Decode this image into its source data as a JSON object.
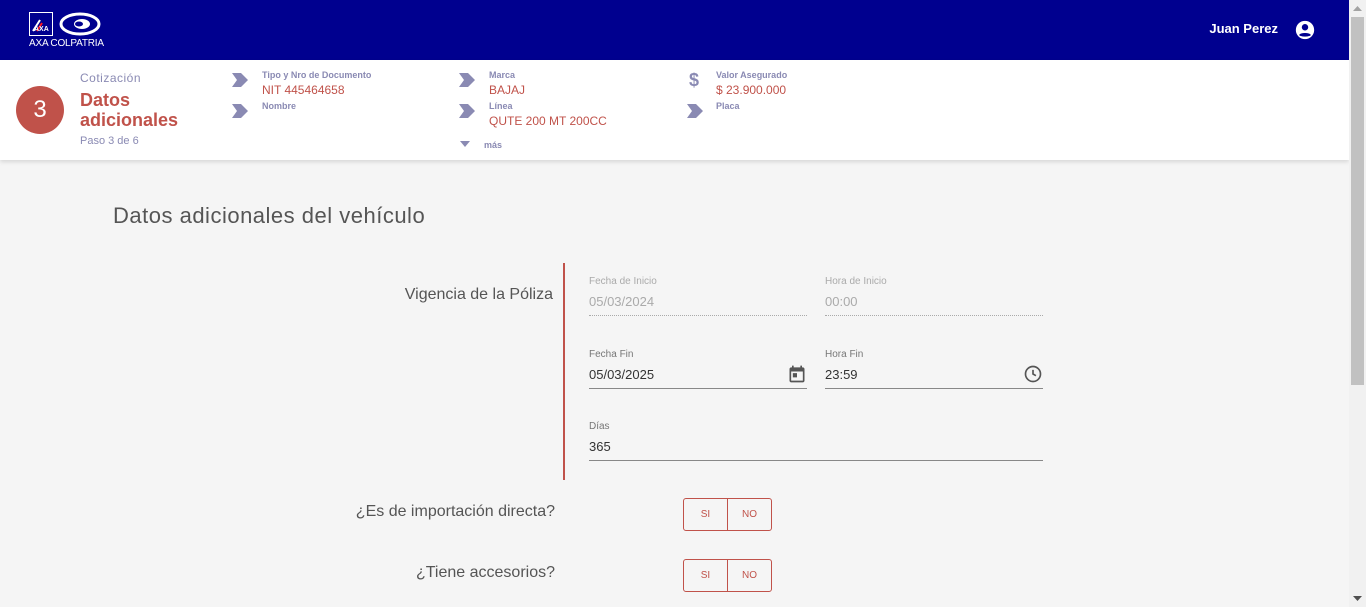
{
  "header": {
    "logo_text": "AXA COLPATRIA",
    "user_name": "Juan Perez"
  },
  "step": {
    "number": "3",
    "caption": "Cotización",
    "title": "Datos adicionales",
    "subtitle": "Paso 3 de 6"
  },
  "summary": {
    "doc_label": "Tipo y Nro de Documento",
    "doc_value": "NIT 445464658",
    "name_label": "Nombre",
    "brand_label": "Marca",
    "brand_value": "BAJAJ",
    "line_label": "Línea",
    "line_value": "QUTE 200 MT 200CC",
    "insured_label": "Valor Asegurado",
    "insured_value": "$ 23.900.000",
    "plate_label": "Placa",
    "more_label": "más",
    "dollar_symbol": "$"
  },
  "page": {
    "heading": "Datos adicionales del vehículo",
    "section_label": "Vigencia de la Póliza"
  },
  "fields": {
    "start_date": {
      "label": "Fecha de Inicio",
      "value": "05/03/2024"
    },
    "start_time": {
      "label": "Hora de Inicio",
      "value": "00:00"
    },
    "end_date": {
      "label": "Fecha Fin",
      "value": "05/03/2025"
    },
    "end_time": {
      "label": "Hora Fin",
      "value": "23:59"
    },
    "days": {
      "label": "Días",
      "value": "365"
    }
  },
  "questions": {
    "import": {
      "text": "¿Es de importación directa?",
      "yes": "SI",
      "no": "NO"
    },
    "accessories": {
      "text": "¿Tiene accesorios?",
      "yes": "SI",
      "no": "NO"
    }
  },
  "colors": {
    "brand_blue": "#00008f",
    "accent_red": "#c0524a",
    "muted_purple": "#8a8ab3"
  },
  "icons": {
    "user": "account-circle-icon",
    "calendar": "calendar-icon",
    "clock": "clock-icon",
    "arrow": "chevron-arrow-icon",
    "more": "caret-down-icon"
  }
}
